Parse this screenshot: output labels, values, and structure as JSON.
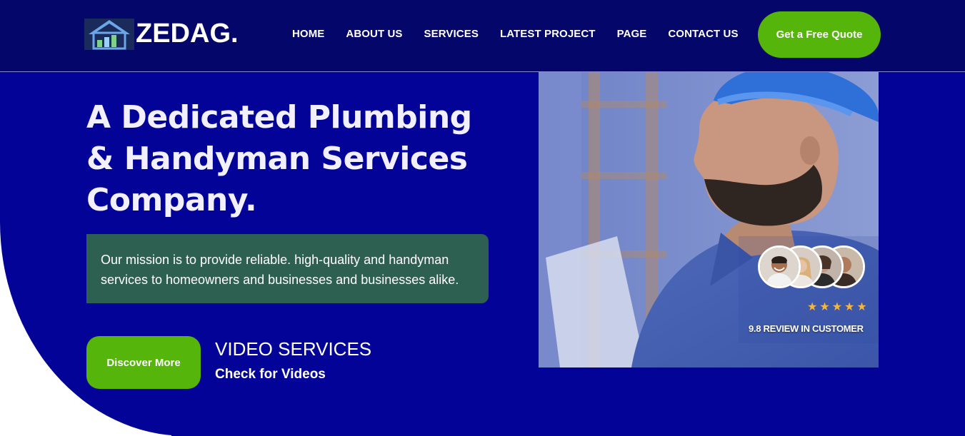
{
  "brand": {
    "name": "ZEDAG.",
    "logo_icon": "house-chart-icon",
    "colors": {
      "header_bg": "#05066a",
      "hero_bg": "#030497",
      "accent_green": "#55b50a",
      "mission_bg": "#2e6052",
      "star": "#f4b63f"
    }
  },
  "nav": {
    "items": [
      {
        "label": "HOME"
      },
      {
        "label": "ABOUT US"
      },
      {
        "label": "SERVICES"
      },
      {
        "label": "LATEST PROJECT"
      },
      {
        "label": "PAGE"
      },
      {
        "label": "CONTACT US"
      }
    ],
    "cta_label": "Get a Free Quote"
  },
  "hero": {
    "headline_line1": "A Dedicated Plumbing",
    "headline_line2": "& Handyman Services",
    "headline_line3": "Company.",
    "mission": "Our mission is to provide reliable. high-quality and handyman services to homeowners and businesses and businesses alike.",
    "discover_label": "Discover More",
    "video_title": "VIDEO SERVICES",
    "video_subtitle": "Check for Videos"
  },
  "photo": {
    "stars": "★★★★★",
    "rating": 5,
    "review_text": "9.8 REVIEW IN CUSTOMER"
  }
}
